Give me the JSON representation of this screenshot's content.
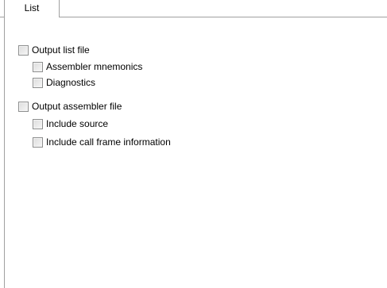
{
  "tabs": [
    {
      "label": "List",
      "selected": true
    }
  ],
  "options": [
    {
      "label": "Output list file",
      "checked": false,
      "level": 0
    },
    {
      "label": "Assembler mnemonics",
      "checked": false,
      "level": 1
    },
    {
      "label": "Diagnostics",
      "checked": false,
      "level": 1
    },
    {
      "label": "Output assembler file",
      "checked": false,
      "level": 0
    },
    {
      "label": "Include source",
      "checked": false,
      "level": 1
    },
    {
      "label": "Include call frame information",
      "checked": false,
      "level": 1
    }
  ]
}
